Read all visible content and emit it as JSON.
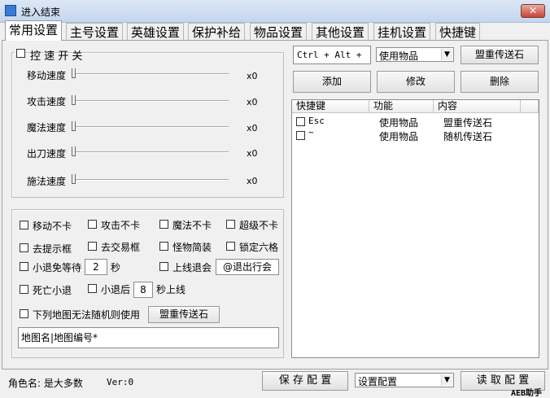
{
  "window": {
    "title": "进入结束",
    "close_glyph": "✕"
  },
  "tabs": [
    "常用设置",
    "主号设置",
    "英雄设置",
    "保护补给",
    "物品设置",
    "其他设置",
    "挂机设置",
    "快捷键"
  ],
  "speed_group": {
    "title": "控 速 开 关",
    "sliders": [
      {
        "label": "移动速度",
        "value": "x0"
      },
      {
        "label": "攻击速度",
        "value": "x0"
      },
      {
        "label": "魔法速度",
        "value": "x0"
      },
      {
        "label": "出刀速度",
        "value": "x0"
      },
      {
        "label": "施法速度",
        "value": "x0"
      }
    ]
  },
  "options": {
    "row1": [
      "移动不卡",
      "攻击不卡",
      "魔法不卡",
      "超级不卡"
    ],
    "row2": [
      "去提示框",
      "去交易框",
      "怪物简装",
      "锁定六格"
    ],
    "small_exit_wait": {
      "label": "小退免等待",
      "value": "2",
      "unit": "秒"
    },
    "online_exit": {
      "label": "上线退会",
      "input": "@退出行会"
    },
    "death_exit": "死亡小退",
    "small_exit_after": {
      "label": "小退后",
      "value": "8",
      "unit": "秒上线"
    },
    "map_random": {
      "label": "下列地图无法随机则使用",
      "button": "盟重传送石"
    },
    "map_field": "地图名|地图编号*"
  },
  "shortcut": {
    "hotkey_field": "Ctrl + Alt +",
    "action_select": "使用物品",
    "target_button": "盟重传送石",
    "add_button": "添加",
    "edit_button": "修改",
    "delete_button": "删除",
    "columns": [
      "快捷键",
      "功能",
      "内容"
    ],
    "rows": [
      {
        "key": "Esc",
        "function": "使用物品",
        "content": "盟重传送石"
      },
      {
        "key": "~",
        "function": "使用物品",
        "content": "随机传送石"
      }
    ]
  },
  "status": {
    "role": "角色名: 是大多数",
    "version": "Ver:0",
    "save_button": "保 存 配 置",
    "config_select": "设置配置",
    "load_button": "读 取 配 置",
    "brand": "AEB助手"
  }
}
